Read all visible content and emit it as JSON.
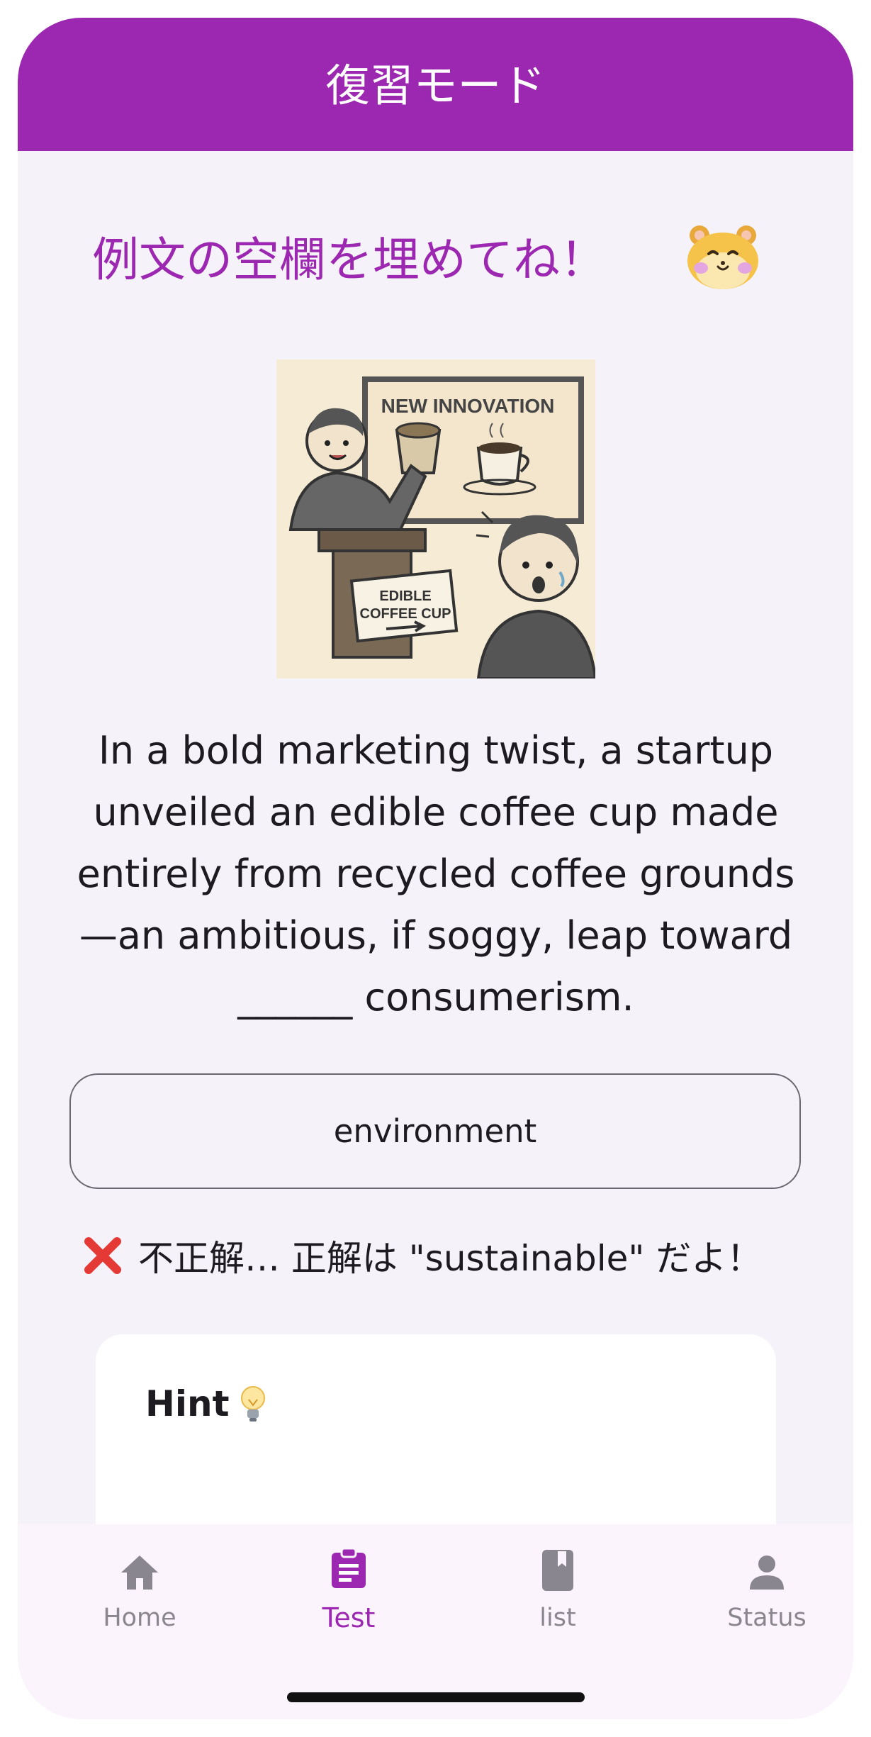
{
  "app_bar": {
    "title": "復習モード"
  },
  "prompt": {
    "text": "例文の空欄を埋めてね！",
    "mascot_icon": "hamster-face-icon"
  },
  "illustration": {
    "sign_text": "NEW INNOVATION",
    "podium_sign_text_line1": "EDIBLE",
    "podium_sign_text_line2": "COFFEE CUP"
  },
  "question": {
    "sentence": "In a bold marketing twist, a startup unveiled an edible coffee cup made entirely from recycled coffee grounds—an ambitious, if soggy, leap toward ______ consumerism."
  },
  "answer": {
    "value": "environment"
  },
  "result": {
    "icon": "cross-icon",
    "text": "不正解… 正解は \"sustainable\" だよ！",
    "color": "#e53935"
  },
  "hint": {
    "title": "Hint",
    "icon": "lightbulb-icon"
  },
  "bottom_nav": {
    "items": [
      {
        "label": "Home",
        "icon": "home-icon",
        "active": false
      },
      {
        "label": "Test",
        "icon": "clipboard-icon",
        "active": true
      },
      {
        "label": "list",
        "icon": "book-icon",
        "active": false
      },
      {
        "label": "Status",
        "icon": "person-icon",
        "active": false
      }
    ]
  },
  "colors": {
    "primary": "#9c27b0",
    "background": "#f5f2fa",
    "nav_background": "#fcf4fd",
    "inactive": "#8a8690",
    "text": "#1d1b20"
  }
}
